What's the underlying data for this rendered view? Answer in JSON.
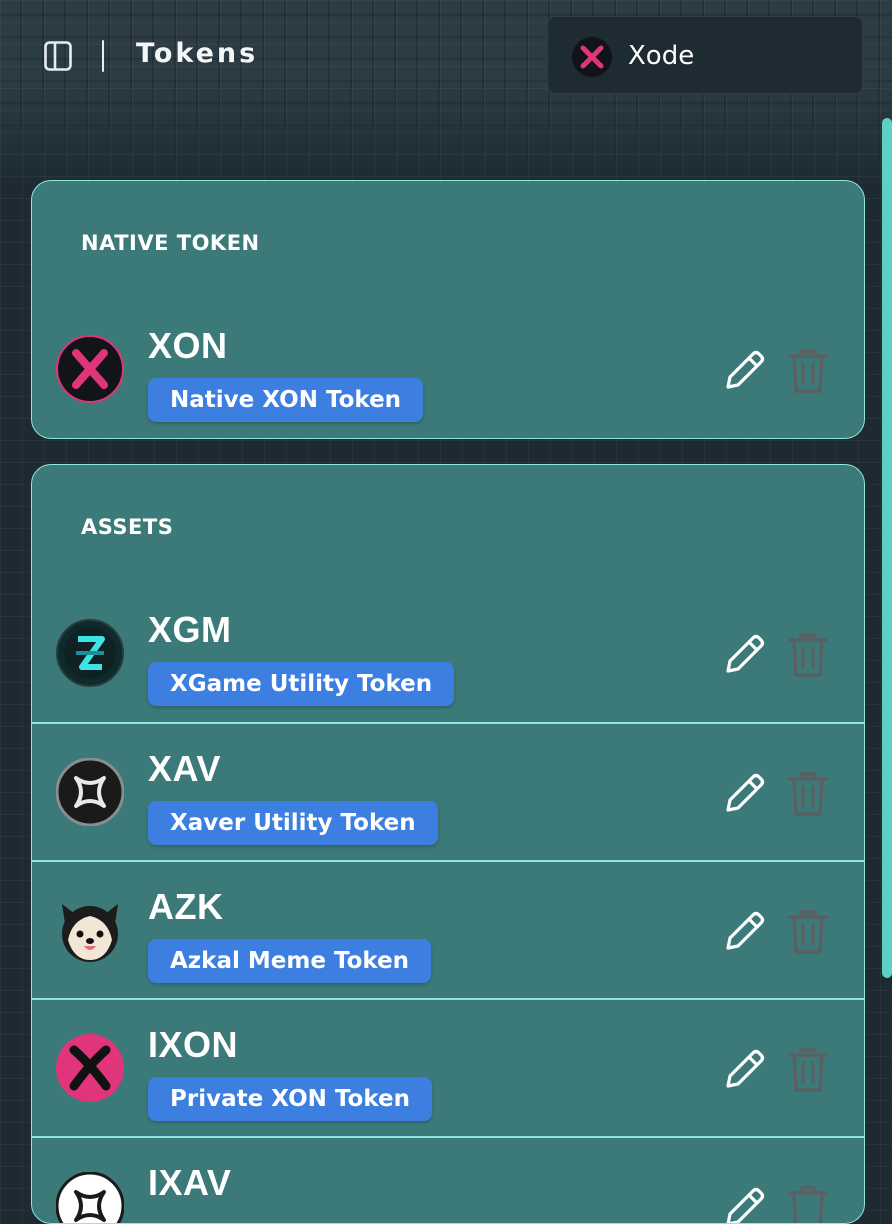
{
  "header": {
    "title": "Tokens",
    "sidebar_toggle_icon": "sidebar-panel-icon",
    "network": {
      "name": "Xode",
      "logo_icon": "xode-x-logo-icon",
      "logo_color": "#e0357b"
    }
  },
  "native_section": {
    "title": "NATIVE TOKEN",
    "tokens": [
      {
        "symbol": "XON",
        "name": "Native XON Token",
        "logo": "xon-logo-icon"
      }
    ]
  },
  "assets_section": {
    "title": "ASSETS",
    "tokens": [
      {
        "symbol": "XGM",
        "name": "XGame Utility Token",
        "logo": "xgm-logo-icon"
      },
      {
        "symbol": "XAV",
        "name": "Xaver Utility Token",
        "logo": "xav-logo-icon"
      },
      {
        "symbol": "AZK",
        "name": "Azkal Meme Token",
        "logo": "azk-dog-logo-icon"
      },
      {
        "symbol": "IXON",
        "name": "Private XON Token",
        "logo": "ixon-logo-icon"
      },
      {
        "symbol": "IXAV",
        "name": "",
        "logo": "ixav-logo-icon"
      }
    ]
  },
  "actions": {
    "edit_icon": "pencil-icon",
    "delete_icon": "trash-icon"
  },
  "colors": {
    "background": "#1d2a31",
    "card": "#3b7a79",
    "card_border": "#8fe6db",
    "badge": "#3d7fe0",
    "brand_pink": "#e0357b",
    "cyan_accent": "#3ee3e3"
  }
}
